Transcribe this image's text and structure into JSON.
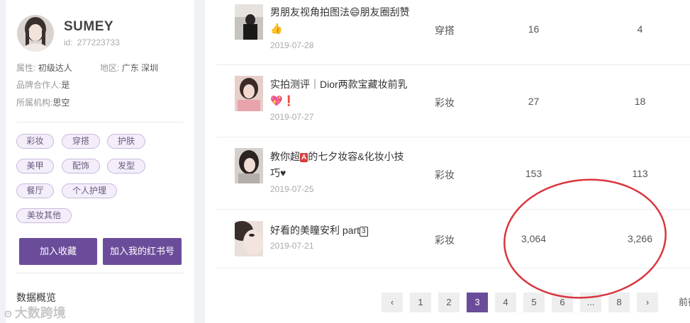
{
  "profile": {
    "username": "SUMEY",
    "id_label": "id:",
    "id_value": "277223733",
    "attr_label": "属性:",
    "attr_value": "初级达人",
    "region_label": "地区:",
    "region_value": "广东 深圳",
    "brand_label": "品牌合作人:",
    "brand_value": "是",
    "org_label": "所属机构:",
    "org_value": "思空"
  },
  "tags": [
    "彩妆",
    "穿搭",
    "护肤",
    "美甲",
    "配饰",
    "发型",
    "餐厅",
    "个人护理",
    "美妆其他"
  ],
  "buttons": {
    "add_favorite": "加入收藏",
    "add_account": "加入我的红书号"
  },
  "section_title": "数据概览",
  "watermark": "大数跨境",
  "posts": [
    {
      "title_a": "男朋友视角拍图法",
      "emoji": "😄",
      "title_b": "朋友圈刮赞",
      "emoji2": "👍",
      "date": "2019-07-28",
      "category": "穿搭",
      "likes": "16",
      "favorites": "4"
    },
    {
      "title_a": "实拍测评｜Dior两款宝藏妆前乳",
      "emoji": "💖",
      "emoji2": "❗",
      "date": "2019-07-27",
      "category": "彩妆",
      "likes": "27",
      "favorites": "18"
    },
    {
      "title_a": "教你超",
      "emoji": "A",
      "title_b": "的七夕妆容&化妆小技巧♥",
      "date": "2019-07-25",
      "category": "彩妆",
      "likes": "153",
      "favorites": "113"
    },
    {
      "title_a": "好看的美瞳安利 part",
      "emoji": "3",
      "date": "2019-07-21",
      "category": "彩妆",
      "likes": "3,064",
      "favorites": "3,266"
    }
  ],
  "pagination": {
    "prev": "‹",
    "pages": [
      "1",
      "2",
      "3",
      "4",
      "5",
      "6",
      "...",
      "8"
    ],
    "current": "3",
    "next": "›",
    "goto": "前往"
  },
  "colors": {
    "accent": "#6b4c9a",
    "tag_bg": "#f3eef9",
    "annotation": "#d9363e"
  }
}
